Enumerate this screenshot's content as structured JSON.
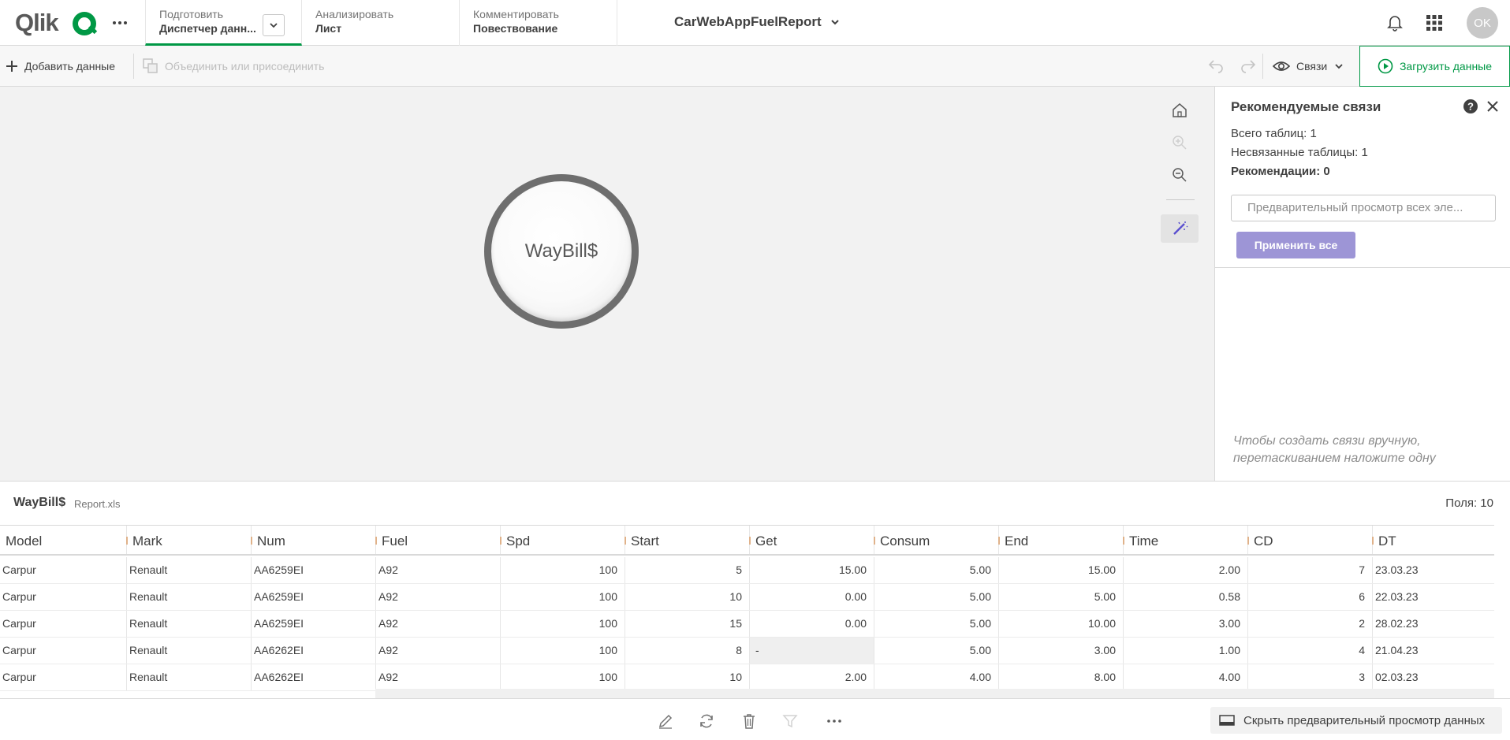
{
  "logo": {
    "text": "Qlik"
  },
  "nav": {
    "tabs": [
      {
        "label": "Подготовить",
        "value": "Диспетчер данн..."
      },
      {
        "label": "Анализировать",
        "value": "Лист"
      },
      {
        "label": "Комментировать",
        "value": "Повествование"
      }
    ],
    "app_title": "CarWebAppFuelReport",
    "avatar_initials": "OK"
  },
  "toolbar": {
    "add_data": "Добавить данные",
    "join": "Объединить или присоединить",
    "associations": "Связи",
    "load_data": "Загрузить данные"
  },
  "canvas": {
    "table_name": "WayBill$"
  },
  "panel": {
    "title": "Рекомендуемые связи",
    "total_tables": "Всего таблиц: 1",
    "unlinked_tables": "Несвязанные таблицы: 1",
    "recommendations": "Рекомендации: 0",
    "preview_placeholder": "Предварительный просмотр всех эле...",
    "apply_all": "Применить все",
    "hint": "Чтобы создать связи вручную, перетаскиванием наложите одну"
  },
  "preview": {
    "table_name": "WayBill$",
    "file_name": "Report.xls",
    "fields_count": "Поля: 10",
    "columns": [
      "Model",
      "Mark",
      "Num",
      "Fuel",
      "Spd",
      "Start",
      "Get",
      "Consum",
      "End",
      "Time",
      "CD",
      "DT"
    ],
    "rows": [
      [
        "Carpur",
        "Renault",
        "AA6259EI",
        "A92",
        "100",
        "5",
        "15.00",
        "5.00",
        "15.00",
        "2.00",
        "7",
        "23.03.23"
      ],
      [
        "Carpur",
        "Renault",
        "AA6259EI",
        "A92",
        "100",
        "10",
        "0.00",
        "5.00",
        "5.00",
        "0.58",
        "6",
        "22.03.23"
      ],
      [
        "Carpur",
        "Renault",
        "AA6259EI",
        "A92",
        "100",
        "15",
        "0.00",
        "5.00",
        "10.00",
        "3.00",
        "2",
        "28.02.23"
      ],
      [
        "Carpur",
        "Renault",
        "AA6262EI",
        "A92",
        "100",
        "8",
        "-",
        "5.00",
        "3.00",
        "1.00",
        "4",
        "21.04.23"
      ],
      [
        "Carpur",
        "Renault",
        "AA6262EI",
        "A92",
        "100",
        "10",
        "2.00",
        "4.00",
        "8.00",
        "4.00",
        "3",
        "02.03.23"
      ]
    ]
  },
  "footer": {
    "hide_preview": "Скрыть предварительный просмотр данных"
  },
  "colors": {
    "accent_green": "#009845",
    "apply_button": "#9d95d6",
    "magic_icon": "#5a4fcf"
  }
}
